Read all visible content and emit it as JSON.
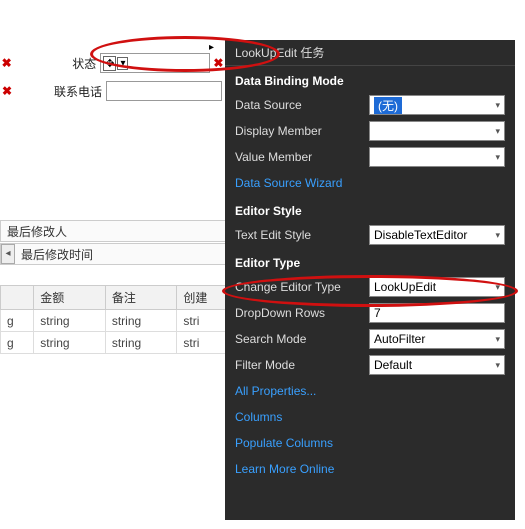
{
  "form": {
    "status_label": "状态",
    "phone_label": "联系电话",
    "modifier_label": "最后修改人",
    "modtime_label": "最后修改时间"
  },
  "grid": {
    "cols": [
      "金额",
      "备注",
      "创建"
    ],
    "row_trunc": "g",
    "cell": "string",
    "cell_trunc": "stri"
  },
  "tasks": {
    "title": "LookUpEdit 任务",
    "sec_binding": "Data Binding Mode",
    "data_source_label": "Data Source",
    "data_source_value": "(无)",
    "display_member_label": "Display Member",
    "value_member_label": "Value Member",
    "wizard_link": "Data Source Wizard",
    "sec_style": "Editor Style",
    "text_edit_style_label": "Text Edit Style",
    "text_edit_style_value": "DisableTextEditor",
    "sec_type": "Editor Type",
    "change_editor_label": "Change Editor Type",
    "change_editor_value": "LookUpEdit",
    "dropdown_rows_label": "DropDown Rows",
    "dropdown_rows_value": "7",
    "search_mode_label": "Search Mode",
    "search_mode_value": "AutoFilter",
    "filter_mode_label": "Filter Mode",
    "filter_mode_value": "Default",
    "all_props_link": "All Properties...",
    "columns_link": "Columns",
    "populate_link": "Populate Columns",
    "learn_link": "Learn More Online"
  },
  "glyphs": {
    "close": "✖",
    "move": "✥",
    "caret": "▾",
    "left": "◂",
    "right": "▸"
  }
}
